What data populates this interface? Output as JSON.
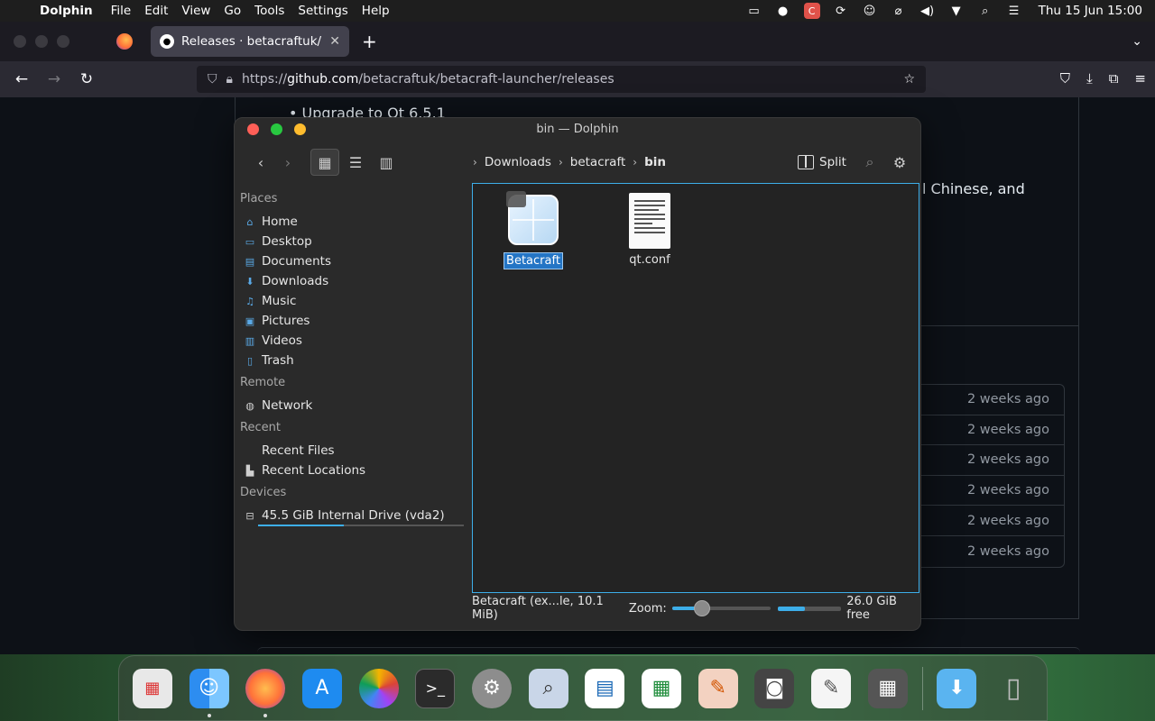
{
  "menubar": {
    "app_name": "Dolphin",
    "menus": [
      "File",
      "Edit",
      "View",
      "Go",
      "Tools",
      "Settings",
      "Help"
    ],
    "clock": "Thu 15 Jun 15:00"
  },
  "browser": {
    "tab_title": "Releases · betacraftuk/betacraft-launcher",
    "url_prefix": "https://",
    "url_host": "github.com",
    "url_path": "/betacraftuk/betacraft-launcher/releases"
  },
  "github": {
    "bullet_text": "Upgrade to Qt 6.5.1",
    "partial_text": "l Chinese, and",
    "asset_times": [
      "2 weeks ago",
      "2 weeks ago",
      "2 weeks ago",
      "2 weeks ago",
      "2 weeks ago",
      "2 weeks ago"
    ]
  },
  "dolphin": {
    "title": "bin — Dolphin",
    "breadcrumbs": [
      "Downloads",
      "betacraft",
      "bin"
    ],
    "split_label": "Split",
    "sidebar": {
      "places_label": "Places",
      "places": [
        "Home",
        "Desktop",
        "Documents",
        "Downloads",
        "Music",
        "Pictures",
        "Videos",
        "Trash"
      ],
      "remote_label": "Remote",
      "remote": [
        "Network"
      ],
      "recent_label": "Recent",
      "recent": [
        "Recent Files",
        "Recent Locations"
      ],
      "devices_label": "Devices",
      "devices": [
        "45.5 GiB Internal Drive (vda2)"
      ],
      "drive_usage": 0.42
    },
    "files": [
      {
        "name": "Betacraft",
        "selected": true
      },
      {
        "name": "qt.conf",
        "selected": false
      }
    ],
    "status": {
      "selection": "Betacraft (ex...le, 10.1 MiB)",
      "zoom_label": "Zoom:",
      "zoom_level": 0.25,
      "free_space": "26.0 GiB free"
    }
  },
  "dock": {
    "apps": [
      "Launchpad",
      "Finder",
      "Firefox",
      "App Store",
      "Photos",
      "Terminal",
      "System Settings",
      "Preview",
      "Writer",
      "Calc",
      "Draw",
      "Cassette",
      "TextEdit",
      "Calculator",
      "Downloads",
      "Trash"
    ]
  }
}
